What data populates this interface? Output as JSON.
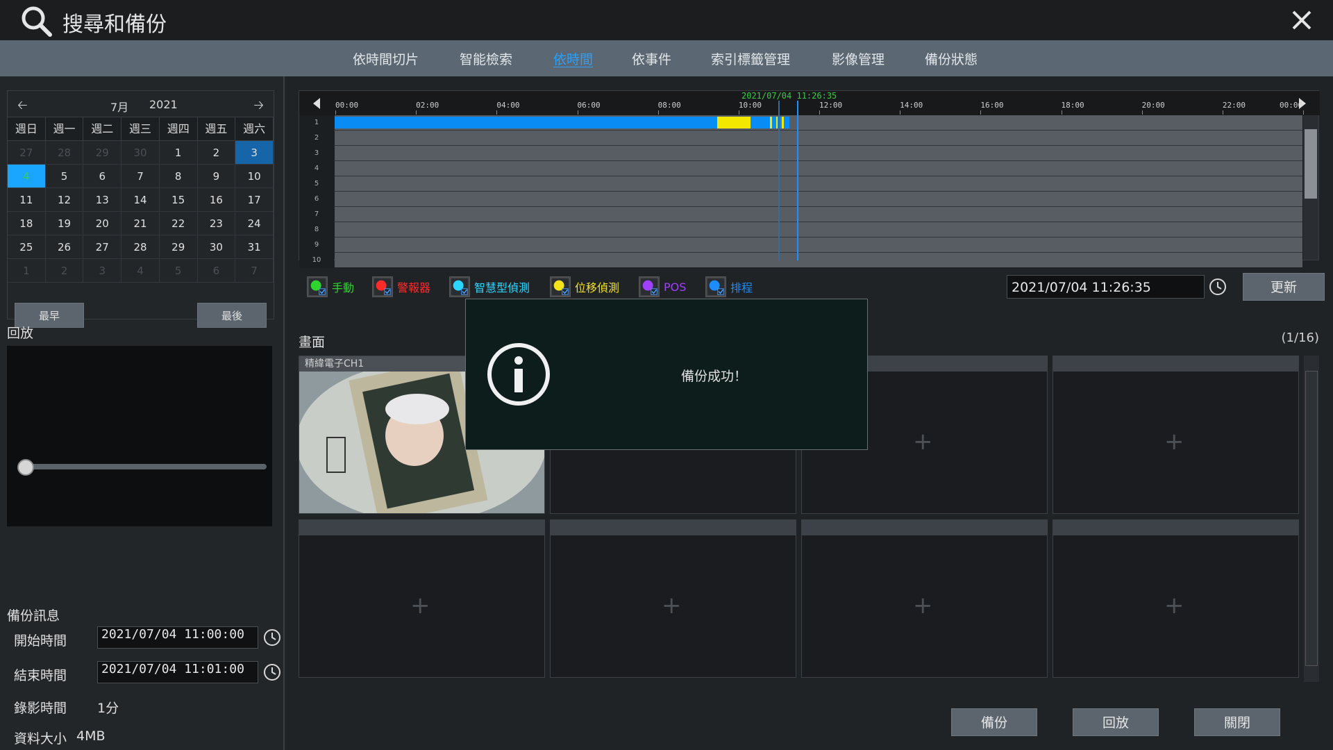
{
  "window": {
    "title": "搜尋和備份",
    "search_icon": "search-icon",
    "close_icon": "close-icon"
  },
  "tabs": [
    {
      "label": "依時間切片"
    },
    {
      "label": "智能檢索"
    },
    {
      "label": "依時間",
      "active": true
    },
    {
      "label": "依事件"
    },
    {
      "label": "索引標籤管理"
    },
    {
      "label": "影像管理"
    },
    {
      "label": "備份狀態"
    }
  ],
  "calendar": {
    "month": "7月",
    "year": "2021",
    "weekdays": [
      "週日",
      "週一",
      "週二",
      "週三",
      "週四",
      "週五",
      "週六"
    ],
    "days": [
      {
        "d": "27",
        "dim": true
      },
      {
        "d": "28",
        "dim": true
      },
      {
        "d": "29",
        "dim": true
      },
      {
        "d": "30",
        "dim": true
      },
      {
        "d": "1"
      },
      {
        "d": "2"
      },
      {
        "d": "3",
        "selected": true
      },
      {
        "d": "4",
        "today": true
      },
      {
        "d": "5"
      },
      {
        "d": "6"
      },
      {
        "d": "7"
      },
      {
        "d": "8"
      },
      {
        "d": "9"
      },
      {
        "d": "10"
      },
      {
        "d": "11"
      },
      {
        "d": "12"
      },
      {
        "d": "13"
      },
      {
        "d": "14"
      },
      {
        "d": "15"
      },
      {
        "d": "16"
      },
      {
        "d": "17"
      },
      {
        "d": "18"
      },
      {
        "d": "19"
      },
      {
        "d": "20"
      },
      {
        "d": "21"
      },
      {
        "d": "22"
      },
      {
        "d": "23"
      },
      {
        "d": "24"
      },
      {
        "d": "25"
      },
      {
        "d": "26"
      },
      {
        "d": "27"
      },
      {
        "d": "28"
      },
      {
        "d": "29"
      },
      {
        "d": "30"
      },
      {
        "d": "31"
      },
      {
        "d": "1",
        "dim": true
      },
      {
        "d": "2",
        "dim": true
      },
      {
        "d": "3",
        "dim": true
      },
      {
        "d": "4",
        "dim": true
      },
      {
        "d": "5",
        "dim": true
      },
      {
        "d": "6",
        "dim": true
      },
      {
        "d": "7",
        "dim": true
      }
    ],
    "earliest_label": "最早",
    "latest_label": "最後"
  },
  "playback": {
    "label": "回放"
  },
  "backup_info": {
    "label": "備份訊息",
    "start_label": "開始時間",
    "start_value": "2021/07/04 11:00:00",
    "end_label": "結束時間",
    "end_value": "2021/07/04 11:01:00",
    "duration_label": "錄影時間",
    "duration_value": "1分",
    "size_label": "資料大小",
    "size_value": "4MB"
  },
  "timeline": {
    "current_time": "2021/07/04 11:26:35",
    "ticks": [
      "00:00",
      "02:00",
      "04:00",
      "06:00",
      "08:00",
      "10:00",
      "12:00",
      "14:00",
      "16:00",
      "18:00",
      "20:00",
      "22:00",
      "00:00"
    ],
    "rows": [
      "1",
      "2",
      "3",
      "4",
      "5",
      "6",
      "7",
      "8",
      "9",
      "10"
    ],
    "recording_color": "#0a8cf5",
    "motion_color": "#f2e800"
  },
  "legend": [
    {
      "label": "手動",
      "color": "#2fd32f",
      "icon": "hand-icon"
    },
    {
      "label": "警報器",
      "color": "#ff2a2a",
      "icon": "alarm-icon"
    },
    {
      "label": "智慧型偵測",
      "color": "#2ad6ff",
      "icon": "smart-detection-icon"
    },
    {
      "label": "位移偵測",
      "color": "#f4e21a",
      "icon": "motion-icon"
    },
    {
      "label": "POS",
      "color": "#a040ff",
      "icon": "pos-icon"
    },
    {
      "label": "排程",
      "color": "#1d8cff",
      "icon": "schedule-icon"
    }
  ],
  "datetime_value": "2021/07/04 11:26:35",
  "update_label": "更新",
  "screen": {
    "label": "畫面",
    "page": "(1/16)",
    "ch1_name": "精緯電子CH1"
  },
  "dialog": {
    "message": "備份成功！"
  },
  "actions": {
    "backup_label": "備份",
    "playback_label": "回放",
    "close_label": "關閉"
  }
}
